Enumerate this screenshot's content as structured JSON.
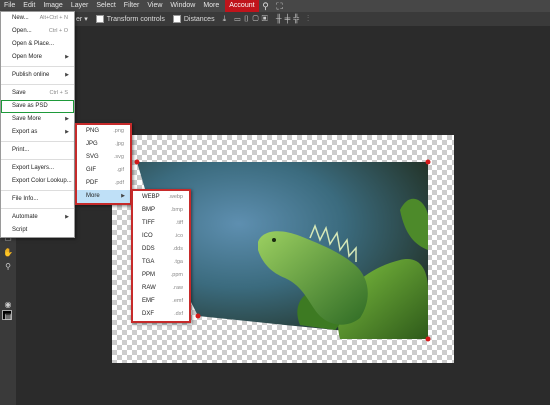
{
  "menubar": {
    "items": [
      "File",
      "Edit",
      "Image",
      "Layer",
      "Select",
      "Filter",
      "View",
      "Window",
      "More"
    ],
    "account": "Account",
    "icons": [
      "search-icon",
      "fullscreen-icon"
    ]
  },
  "optbar": {
    "dropdown_suffix": "er",
    "transform_controls": "Transform controls",
    "distances": "Distances",
    "glyphs": [
      "⤓",
      "▭",
      "▯",
      "▢",
      "▣",
      "╫",
      "╪",
      "╬",
      "⋮",
      "⊞",
      "⊟",
      "⊠"
    ]
  },
  "file_menu": {
    "items": [
      {
        "label": "New...",
        "shortcut": "Alt+Ctrl + N"
      },
      {
        "label": "Open...",
        "shortcut": "Ctrl + O"
      },
      {
        "label": "Open & Place..."
      },
      {
        "label": "Open More",
        "arrow": true
      },
      {
        "sep": true
      },
      {
        "label": "Publish online",
        "arrow": true
      },
      {
        "sep": true
      },
      {
        "label": "Save",
        "shortcut": "Ctrl + S"
      },
      {
        "label": "Save as PSD",
        "highlight": "green"
      },
      {
        "label": "Save More",
        "arrow": true
      },
      {
        "label": "Export as",
        "arrow": true
      },
      {
        "sep": true
      },
      {
        "label": "Print..."
      },
      {
        "sep": true
      },
      {
        "label": "Export Layers..."
      },
      {
        "label": "Export Color Lookup..."
      },
      {
        "sep": true
      },
      {
        "label": "File Info..."
      },
      {
        "sep": true
      },
      {
        "label": "Automate",
        "arrow": true
      },
      {
        "label": "Script"
      }
    ]
  },
  "export_submenu": {
    "items": [
      {
        "label": "PNG",
        "ext": ".png"
      },
      {
        "label": "JPG",
        "ext": ".jpg"
      },
      {
        "label": "SVG",
        "ext": ".svg"
      },
      {
        "label": "GIF",
        "ext": ".gif"
      },
      {
        "label": "PDF",
        "ext": ".pdf"
      },
      {
        "label": "More",
        "arrow": true,
        "hover": true
      }
    ]
  },
  "more_submenu": {
    "items": [
      {
        "label": "WEBP",
        "ext": ".webp"
      },
      {
        "label": "BMP",
        "ext": ".bmp"
      },
      {
        "label": "TIFF",
        "ext": ".tiff"
      },
      {
        "label": "ICO",
        "ext": ".ico"
      },
      {
        "label": "DDS",
        "ext": ".dds"
      },
      {
        "label": "TGA",
        "ext": ".tga"
      },
      {
        "label": "PPM",
        "ext": ".ppm"
      },
      {
        "label": "RAW",
        "ext": ".raw"
      },
      {
        "label": "EMF",
        "ext": ".emf"
      },
      {
        "label": "DXF",
        "ext": ".dxf"
      }
    ]
  },
  "colors": {
    "account_bg": "#c0141b",
    "highlight_green": "#1e9a3a",
    "submenu_border": "#c62a2a",
    "hover_row": "#bfe0f7",
    "handle_red": "#d41a1a"
  }
}
